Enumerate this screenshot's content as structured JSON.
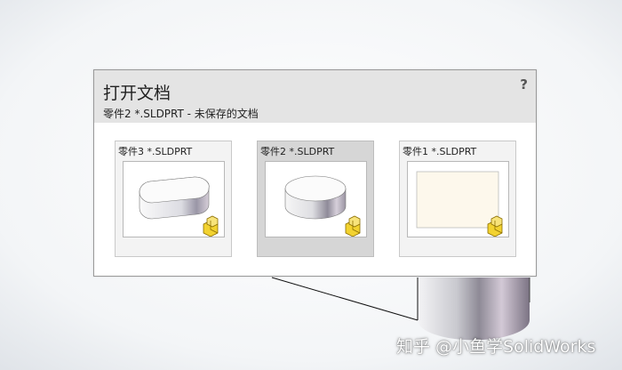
{
  "dialog": {
    "title": "打开文档",
    "subtitle": "零件2 *.SLDPRT - 未保存的文档",
    "help_label": "?"
  },
  "documents": [
    {
      "label": "零件3 *.SLDPRT",
      "icon": "rounded-slot-part-thumbnail",
      "selected": false
    },
    {
      "label": "零件2 *.SLDPRT",
      "icon": "cylinder-part-thumbnail",
      "selected": true
    },
    {
      "label": "零件1 *.SLDPRT",
      "icon": "sketch-plane-thumbnail",
      "selected": false
    }
  ],
  "part_badge_icon": "solidworks-part-icon",
  "colors": {
    "header_bg": "#e4e4e4",
    "card_bg": "#f3f3f3",
    "card_selected_bg": "#d6d6d6",
    "badge_yellow": "#f2d230",
    "viewport_bg": "#e9ecef"
  },
  "watermark": "知乎 @小鱼学SolidWorks"
}
